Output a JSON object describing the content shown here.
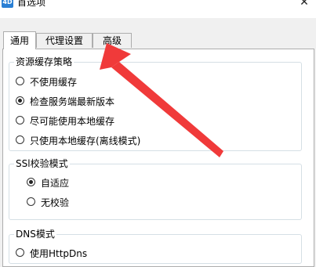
{
  "window": {
    "title": "首选项",
    "app_icon_text": "4D",
    "close_symbol": "✕"
  },
  "tabs": [
    {
      "label": "通用",
      "active": true
    },
    {
      "label": "代理设置",
      "active": false
    },
    {
      "label": "高级",
      "active": false
    }
  ],
  "cache_group": {
    "title": "资源缓存策略",
    "options": [
      {
        "label": "不使用缓存",
        "selected": false
      },
      {
        "label": "检查服务端最新版本",
        "selected": true
      },
      {
        "label": "尽可能使用本地缓存",
        "selected": false
      },
      {
        "label": "只使用本地缓存(离线模式)",
        "selected": false
      }
    ]
  },
  "ssl_group": {
    "title": "SSl校验模式",
    "options": [
      {
        "label": "自适应",
        "selected": true
      },
      {
        "label": "无校验",
        "selected": false
      }
    ]
  },
  "dns_group": {
    "title": "DNS模式",
    "options": [
      {
        "label": "使用HttpDns",
        "selected": false
      }
    ]
  },
  "annotation": {
    "arrow_color": "#f03a3a"
  }
}
